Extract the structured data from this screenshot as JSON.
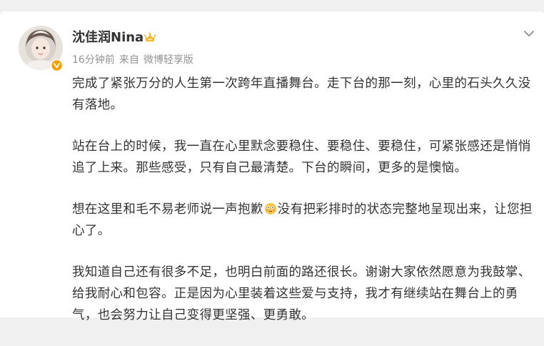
{
  "post": {
    "author": "沈佳润Nina",
    "time": "16分钟前",
    "source_prefix": "来自",
    "source": "微博轻享版",
    "paragraphs": [
      "完成了紧张万分的人生第一次跨年直播舞台。走下台的那一刻，心里的石头久久没有落地。",
      "站在台上的时候，我一直在心里默念要稳住、要稳住、要稳住，可紧张感还是悄悄追了上来。那些感受，只有自己最清楚。下台的瞬间，更多的是懊恼。",
      "没有把彩排时的状态完整地呈现出来，让您担心了。",
      "我知道自己还有很多不足，也明白前面的路还很长。谢谢大家依然愿意为我鼓掌、给我耐心和包容。正是因为心里装着这些爱与支持，我才有继续站在舞台上的勇气，也会努力让自己变得更坚强、更勇敢。"
    ],
    "paragraph3_lead": "想在这里和毛不易老师说一声抱歉",
    "emoji_name": "flushed-face-emoji",
    "colors": {
      "text": "#333333",
      "meta": "#939393",
      "verified_badge": "#f7a100",
      "crown": "#f5b82e"
    }
  }
}
